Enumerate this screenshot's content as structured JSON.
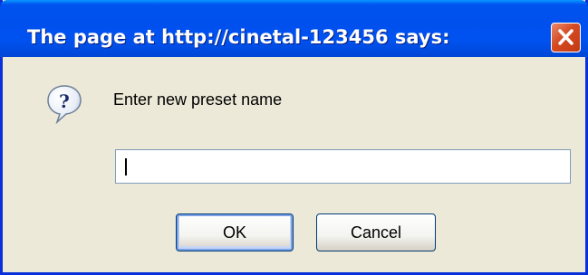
{
  "window": {
    "title": "The page at http://cinetal-123456 says:",
    "close_icon": "close-icon"
  },
  "dialog": {
    "icon": "question-icon",
    "prompt": "Enter new preset name",
    "input": {
      "value": "",
      "placeholder": ""
    },
    "buttons": {
      "ok_label": "OK",
      "cancel_label": "Cancel"
    }
  },
  "colors": {
    "titlebar": "#0050ee",
    "window_bg": "#ece9d8",
    "close_button": "#d54a22",
    "input_border": "#7f9db9",
    "button_border": "#003c74"
  }
}
